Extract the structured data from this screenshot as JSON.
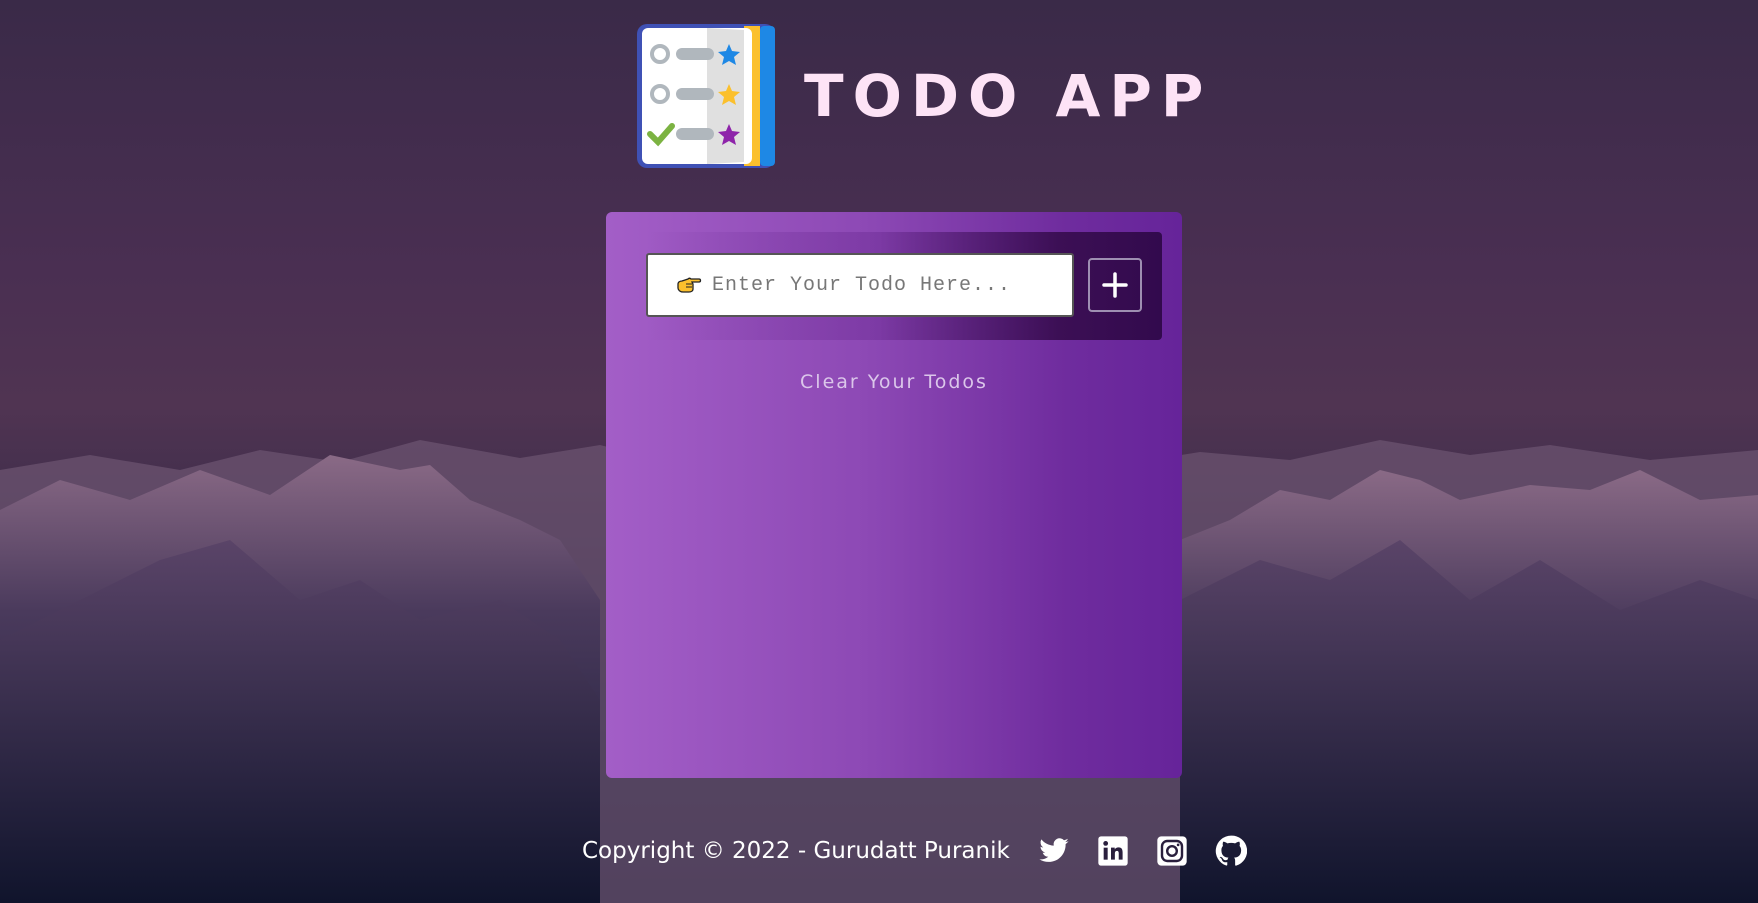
{
  "header": {
    "title": "TODO APP",
    "logo_icon": "todo-list-logo-icon"
  },
  "todo_form": {
    "input_value": "",
    "placeholder": "Enter Your Todo Here...",
    "input_icon": "pointing-hand-icon",
    "add_icon": "plus-icon"
  },
  "clear_label": "Clear Your Todos",
  "footer": {
    "copyright": "Copyright © 2022 - Gurudatt Puranik",
    "social_icons": [
      "twitter-icon",
      "linkedin-icon",
      "instagram-icon",
      "github-icon"
    ]
  },
  "colors": {
    "card_start": "#a35ec7",
    "card_end": "#66249a",
    "title": "#fde3f6",
    "clear_text": "#dbc6ea"
  }
}
